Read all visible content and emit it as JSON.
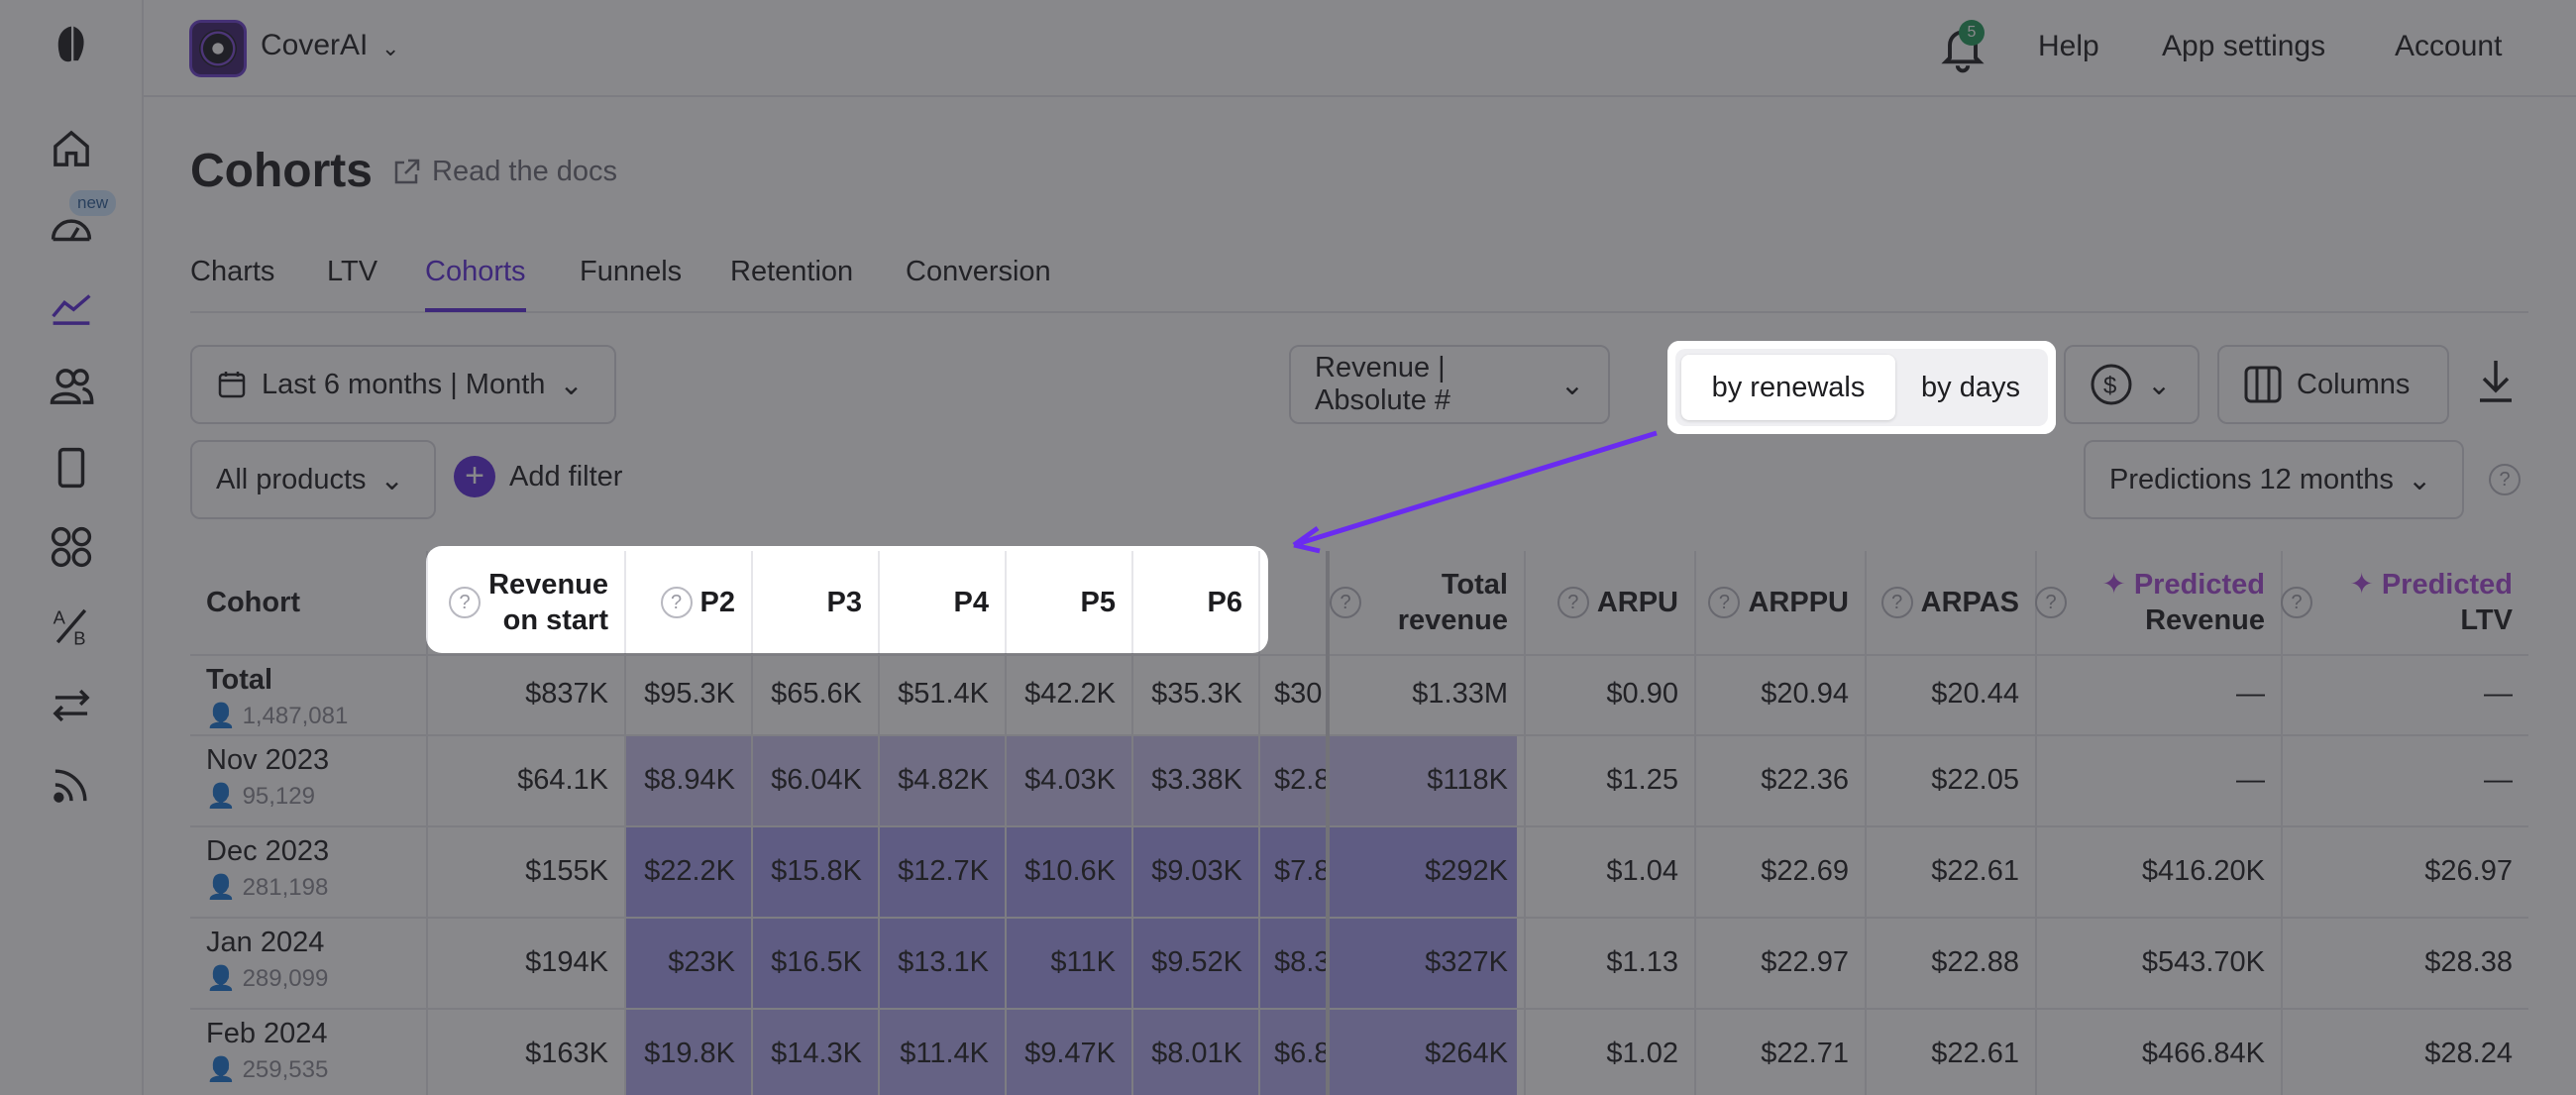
{
  "sidebar": {
    "badge_new": "new"
  },
  "topbar": {
    "app_name": "CoverAI",
    "notifications_count": "5",
    "links": [
      "Help",
      "App settings",
      "Account"
    ]
  },
  "page": {
    "title": "Cohorts",
    "docs_link": "Read the docs"
  },
  "tabs": [
    "Charts",
    "LTV",
    "Cohorts",
    "Funnels",
    "Retention",
    "Conversion"
  ],
  "controls": {
    "period": "Last 6 months | Month",
    "metric": "Revenue | Absolute #",
    "segment": [
      "by renewals",
      "by days"
    ],
    "columns": "Columns",
    "products": "All products",
    "add_filter": "Add filter",
    "predictions": "Predictions 12 months"
  },
  "table": {
    "headers": {
      "cohort": "Cohort",
      "rev_start_1": "Revenue",
      "rev_start_2": "on start",
      "p2": "P2",
      "p3": "P3",
      "p4": "P4",
      "p5": "P5",
      "p6": "P6",
      "total_1": "Total",
      "total_2": "revenue",
      "arpu": "ARPU",
      "arppu": "ARPPU",
      "arpas": "ARPAS",
      "pred_rev_1": "Predicted",
      "pred_rev_2": "Revenue",
      "pred_ltv_1": "Predicted",
      "pred_ltv_2": "LTV"
    },
    "rows": [
      {
        "name": "Total",
        "count": "1,487,081",
        "start": "$837K",
        "p2": "$95.3K",
        "p3": "$65.6K",
        "p4": "$51.4K",
        "p5": "$42.2K",
        "p6": "$35.3K",
        "p7": "$30",
        "total": "$1.33M",
        "arpu": "$0.90",
        "arppu": "$20.94",
        "arpas": "$20.44",
        "pred_rev": "—",
        "pred_ltv": "—"
      },
      {
        "name": "Nov 2023",
        "count": "95,129",
        "start": "$64.1K",
        "p2": "$8.94K",
        "p3": "$6.04K",
        "p4": "$4.82K",
        "p5": "$4.03K",
        "p6": "$3.38K",
        "p7": "$2.8",
        "total": "$118K",
        "arpu": "$1.25",
        "arppu": "$22.36",
        "arpas": "$22.05",
        "pred_rev": "—",
        "pred_ltv": "—"
      },
      {
        "name": "Dec 2023",
        "count": "281,198",
        "start": "$155K",
        "p2": "$22.2K",
        "p3": "$15.8K",
        "p4": "$12.7K",
        "p5": "$10.6K",
        "p6": "$9.03K",
        "p7": "$7.8",
        "total": "$292K",
        "arpu": "$1.04",
        "arppu": "$22.69",
        "arpas": "$22.61",
        "pred_rev": "$416.20K",
        "pred_ltv": "$26.97"
      },
      {
        "name": "Jan 2024",
        "count": "289,099",
        "start": "$194K",
        "p2": "$23K",
        "p3": "$16.5K",
        "p4": "$13.1K",
        "p5": "$11K",
        "p6": "$9.52K",
        "p7": "$8.3",
        "total": "$327K",
        "arpu": "$1.13",
        "arppu": "$22.97",
        "arpas": "$22.88",
        "pred_rev": "$543.70K",
        "pred_ltv": "$28.38"
      },
      {
        "name": "Feb 2024",
        "count": "259,535",
        "start": "$163K",
        "p2": "$19.8K",
        "p3": "$14.3K",
        "p4": "$11.4K",
        "p5": "$9.47K",
        "p6": "$8.01K",
        "p7": "$6.8",
        "total": "$264K",
        "arpu": "$1.02",
        "arppu": "$22.71",
        "arpas": "$22.61",
        "pred_rev": "$466.84K",
        "pred_ltv": "$28.24"
      }
    ]
  },
  "colors": {
    "accent": "#5b2bd9",
    "predicted": "#a64ad6",
    "heat_strong": "#9d95ea",
    "heat_light": "#d9d5f5"
  }
}
